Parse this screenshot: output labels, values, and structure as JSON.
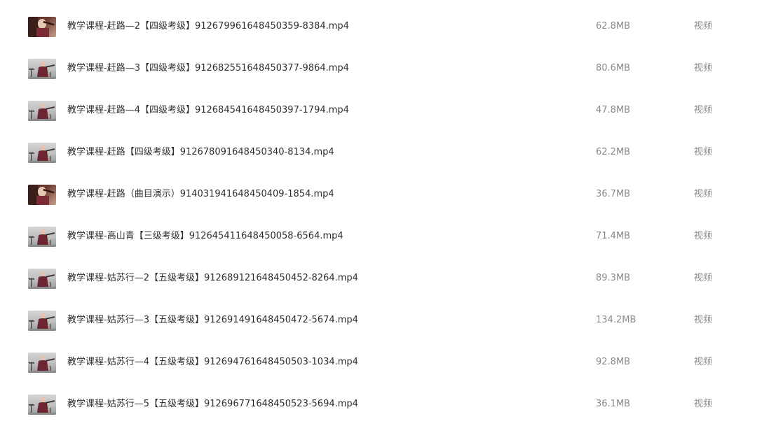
{
  "files": [
    {
      "thumb": "performer-closeup",
      "name": "教学课程-赶路—2【四级考级】912679961648450359-8384.mp4",
      "size": "62.8MB",
      "type": "视频"
    },
    {
      "thumb": "performer-seated",
      "name": "教学课程-赶路—3【四级考级】912682551648450377-9864.mp4",
      "size": "80.6MB",
      "type": "视频"
    },
    {
      "thumb": "performer-seated",
      "name": "教学课程-赶路—4【四级考级】912684541648450397-1794.mp4",
      "size": "47.8MB",
      "type": "视频"
    },
    {
      "thumb": "performer-seated",
      "name": "教学课程-赶路【四级考级】912678091648450340-8134.mp4",
      "size": "62.2MB",
      "type": "视频"
    },
    {
      "thumb": "performer-closeup",
      "name": "教学课程-赶路（曲目演示）914031941648450409-1854.mp4",
      "size": "36.7MB",
      "type": "视频"
    },
    {
      "thumb": "performer-seated",
      "name": "教学课程-高山青【三级考级】912645411648450058-6564.mp4",
      "size": "71.4MB",
      "type": "视频"
    },
    {
      "thumb": "performer-seated",
      "name": "教学课程-姑苏行—2【五级考级】912689121648450452-8264.mp4",
      "size": "89.3MB",
      "type": "视频"
    },
    {
      "thumb": "performer-seated",
      "name": "教学课程-姑苏行—3【五级考级】912691491648450472-5674.mp4",
      "size": "134.2MB",
      "type": "视频"
    },
    {
      "thumb": "performer-seated",
      "name": "教学课程-姑苏行—4【五级考级】912694761648450503-1034.mp4",
      "size": "92.8MB",
      "type": "视频"
    },
    {
      "thumb": "performer-seated",
      "name": "教学课程-姑苏行—5【五级考级】912696771648450523-5694.mp4",
      "size": "36.1MB",
      "type": "视频"
    }
  ]
}
